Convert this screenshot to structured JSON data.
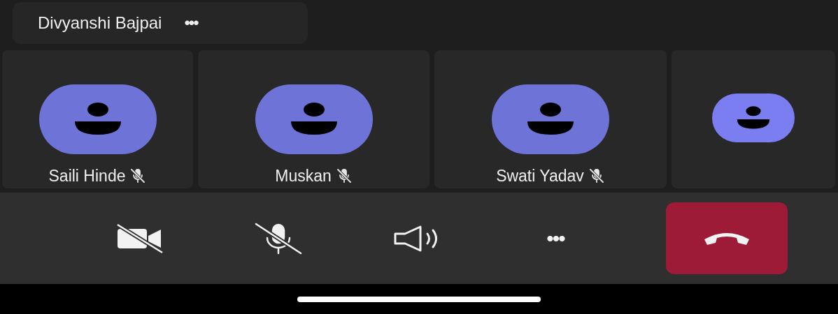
{
  "speaker_chip": {
    "name": "Divyanshi Bajpai",
    "more": "•••"
  },
  "participants": [
    {
      "kind": "full",
      "name": "Saili Hinde",
      "muted": true
    },
    {
      "kind": "full",
      "name": "Muskan",
      "muted": true
    },
    {
      "kind": "full",
      "name": "Swati Yadav",
      "muted": true
    },
    {
      "kind": "partial"
    }
  ],
  "controls": [
    {
      "kind": "camera",
      "on": false
    },
    {
      "kind": "mic",
      "on": false
    },
    {
      "kind": "speaker",
      "on": true
    },
    {
      "kind": "more",
      "label": "•••"
    },
    {
      "kind": "hangup"
    }
  ]
}
